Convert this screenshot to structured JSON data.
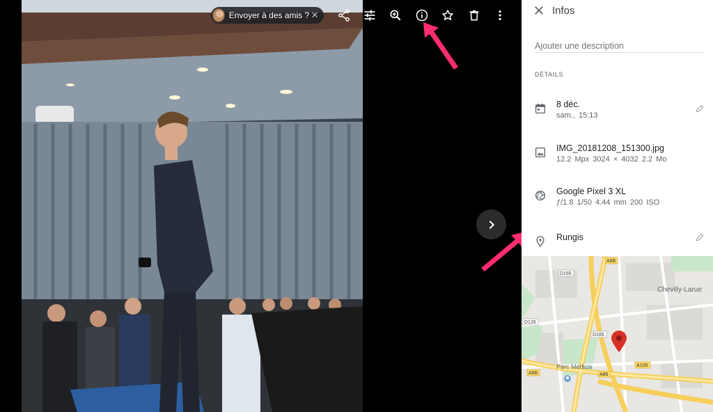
{
  "toolbar": {
    "send_chip_label": "Envoyer à des amis ?",
    "send_chip_close": "✕",
    "icons": [
      "share-icon",
      "tune-icon",
      "zoom-in-icon",
      "info-icon",
      "star-icon",
      "delete-icon",
      "more-vert-icon"
    ]
  },
  "info_panel": {
    "title": "Infos",
    "description_placeholder": "Ajouter une description",
    "section_label": "DÉTAILS",
    "date": {
      "main": "8 déc.",
      "sub": "sam., 15:13"
    },
    "file": {
      "main": "IMG_20181208_151300.jpg",
      "sub": "12.2 Mpx   3024 × 4032   2.2 Mo"
    },
    "camera": {
      "main": "Google Pixel 3 XL",
      "sub": "ƒ/1.8   1/50   4.44 mm   200 ISO"
    },
    "location": {
      "main": "Rungis"
    }
  },
  "map": {
    "labels": {
      "a6b_top": "A6B",
      "d165_left": "D165",
      "chevilly": "Chevilly-Larue",
      "d126": "D126",
      "d165_mid": "D165",
      "parc": "Parc Médicis",
      "a106": "A106",
      "a6b_bottom": "A6B",
      "a86": "A86"
    }
  },
  "colors": {
    "annotation_arrow": "#ff2d6f",
    "map_pin": "#d93025",
    "road_major": "#f6cf5c"
  }
}
